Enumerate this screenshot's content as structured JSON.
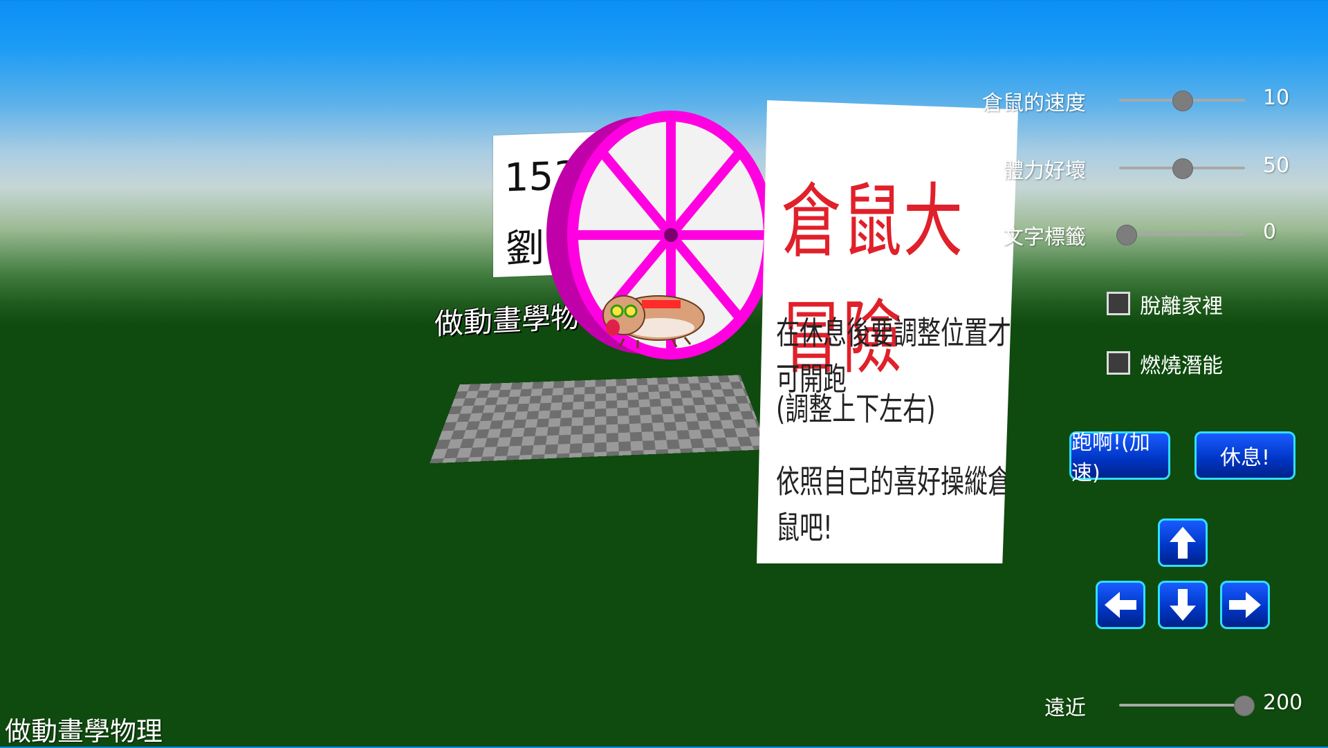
{
  "back_card": {
    "line1": "153",
    "line2": "劉"
  },
  "floor": {
    "label": "做動畫學物"
  },
  "sign": {
    "title": "倉鼠大冒險",
    "line1": "在休息後要調整位置才可開跑",
    "line2": "(調整上下左右)",
    "line3": "依照自己的喜好操縱倉鼠吧!"
  },
  "controls": {
    "speed": {
      "label": "倉鼠的速度",
      "value": "10",
      "fraction": 0.5
    },
    "stamina": {
      "label": "體力好壞",
      "value": "50",
      "fraction": 0.5
    },
    "text_tag": {
      "label": "文字標籤",
      "value": "0",
      "fraction": 0.0
    },
    "escape_home": {
      "label": "脫離家裡",
      "checked": false
    },
    "burn_potential": {
      "label": "燃燒潛能",
      "checked": false
    },
    "run_button": "跑啊!(加速)",
    "rest_button": "休息!",
    "distance": {
      "label": "遠近",
      "value": "200",
      "fraction": 1.0
    }
  },
  "footer": {
    "title": "做動畫學物理"
  },
  "colors": {
    "wheel": "#ff00e0",
    "button_border": "#2ee0ff",
    "sign_title": "#e0202a"
  }
}
